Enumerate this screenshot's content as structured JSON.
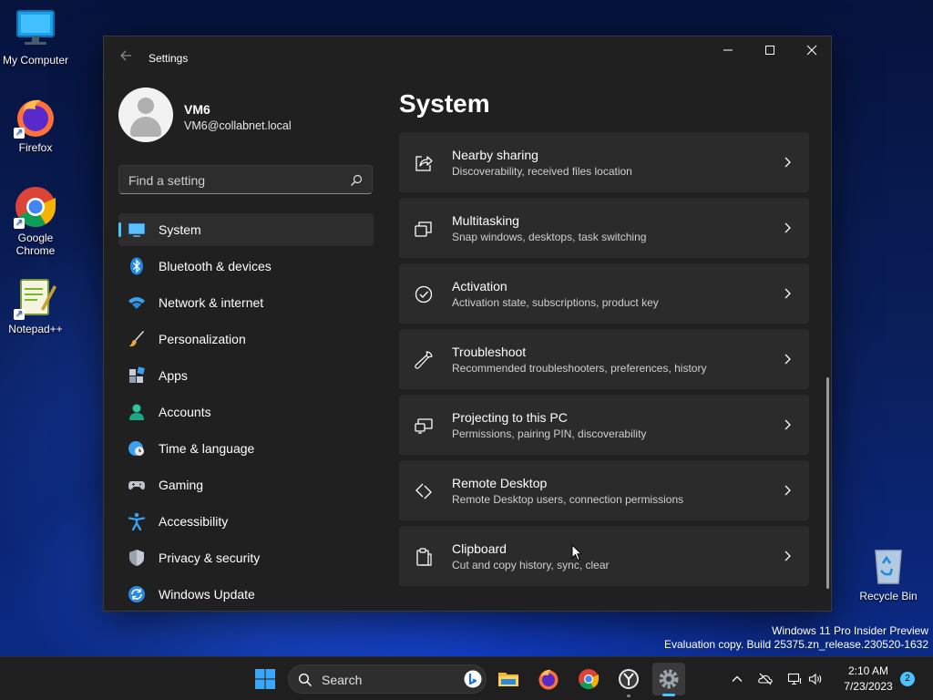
{
  "desktop": {
    "icons": [
      {
        "label": "My Computer"
      },
      {
        "label": "Firefox"
      },
      {
        "label": "Google Chrome"
      },
      {
        "label": "Notepad++"
      },
      {
        "label": "Recycle Bin"
      }
    ],
    "watermark": {
      "line1": "Windows 11 Pro Insider Preview",
      "line2": "Evaluation copy. Build 25375.zn_release.230520-1632"
    }
  },
  "window": {
    "app_title": "Settings",
    "user": {
      "name": "VM6",
      "email": "VM6@collabnet.local"
    },
    "search": {
      "placeholder": "Find a setting",
      "value": ""
    },
    "nav": [
      {
        "label": "System",
        "icon": "monitor-icon",
        "active": true
      },
      {
        "label": "Bluetooth & devices",
        "icon": "bluetooth-icon"
      },
      {
        "label": "Network & internet",
        "icon": "wifi-icon"
      },
      {
        "label": "Personalization",
        "icon": "paintbrush-icon"
      },
      {
        "label": "Apps",
        "icon": "apps-icon"
      },
      {
        "label": "Accounts",
        "icon": "person-icon"
      },
      {
        "label": "Time & language",
        "icon": "clock-globe-icon"
      },
      {
        "label": "Gaming",
        "icon": "gamepad-icon"
      },
      {
        "label": "Accessibility",
        "icon": "accessibility-icon"
      },
      {
        "label": "Privacy & security",
        "icon": "shield-icon"
      },
      {
        "label": "Windows Update",
        "icon": "update-icon"
      }
    ],
    "page_title": "System",
    "cards": [
      {
        "title": "Nearby sharing",
        "desc": "Discoverability, received files location",
        "icon": "share-icon"
      },
      {
        "title": "Multitasking",
        "desc": "Snap windows, desktops, task switching",
        "icon": "multitask-icon"
      },
      {
        "title": "Activation",
        "desc": "Activation state, subscriptions, product key",
        "icon": "check-circle-icon"
      },
      {
        "title": "Troubleshoot",
        "desc": "Recommended troubleshooters, preferences, history",
        "icon": "wrench-icon"
      },
      {
        "title": "Projecting to this PC",
        "desc": "Permissions, pairing PIN, discoverability",
        "icon": "projector-icon"
      },
      {
        "title": "Remote Desktop",
        "desc": "Remote Desktop users, connection permissions",
        "icon": "remote-desktop-icon"
      },
      {
        "title": "Clipboard",
        "desc": "Cut and copy history, sync, clear",
        "icon": "clipboard-icon"
      }
    ]
  },
  "taskbar": {
    "search_label": "Search",
    "clock_time": "2:10 AM",
    "clock_date": "7/23/2023",
    "notification_count": "2",
    "accent_color": "#4cc2ff"
  }
}
